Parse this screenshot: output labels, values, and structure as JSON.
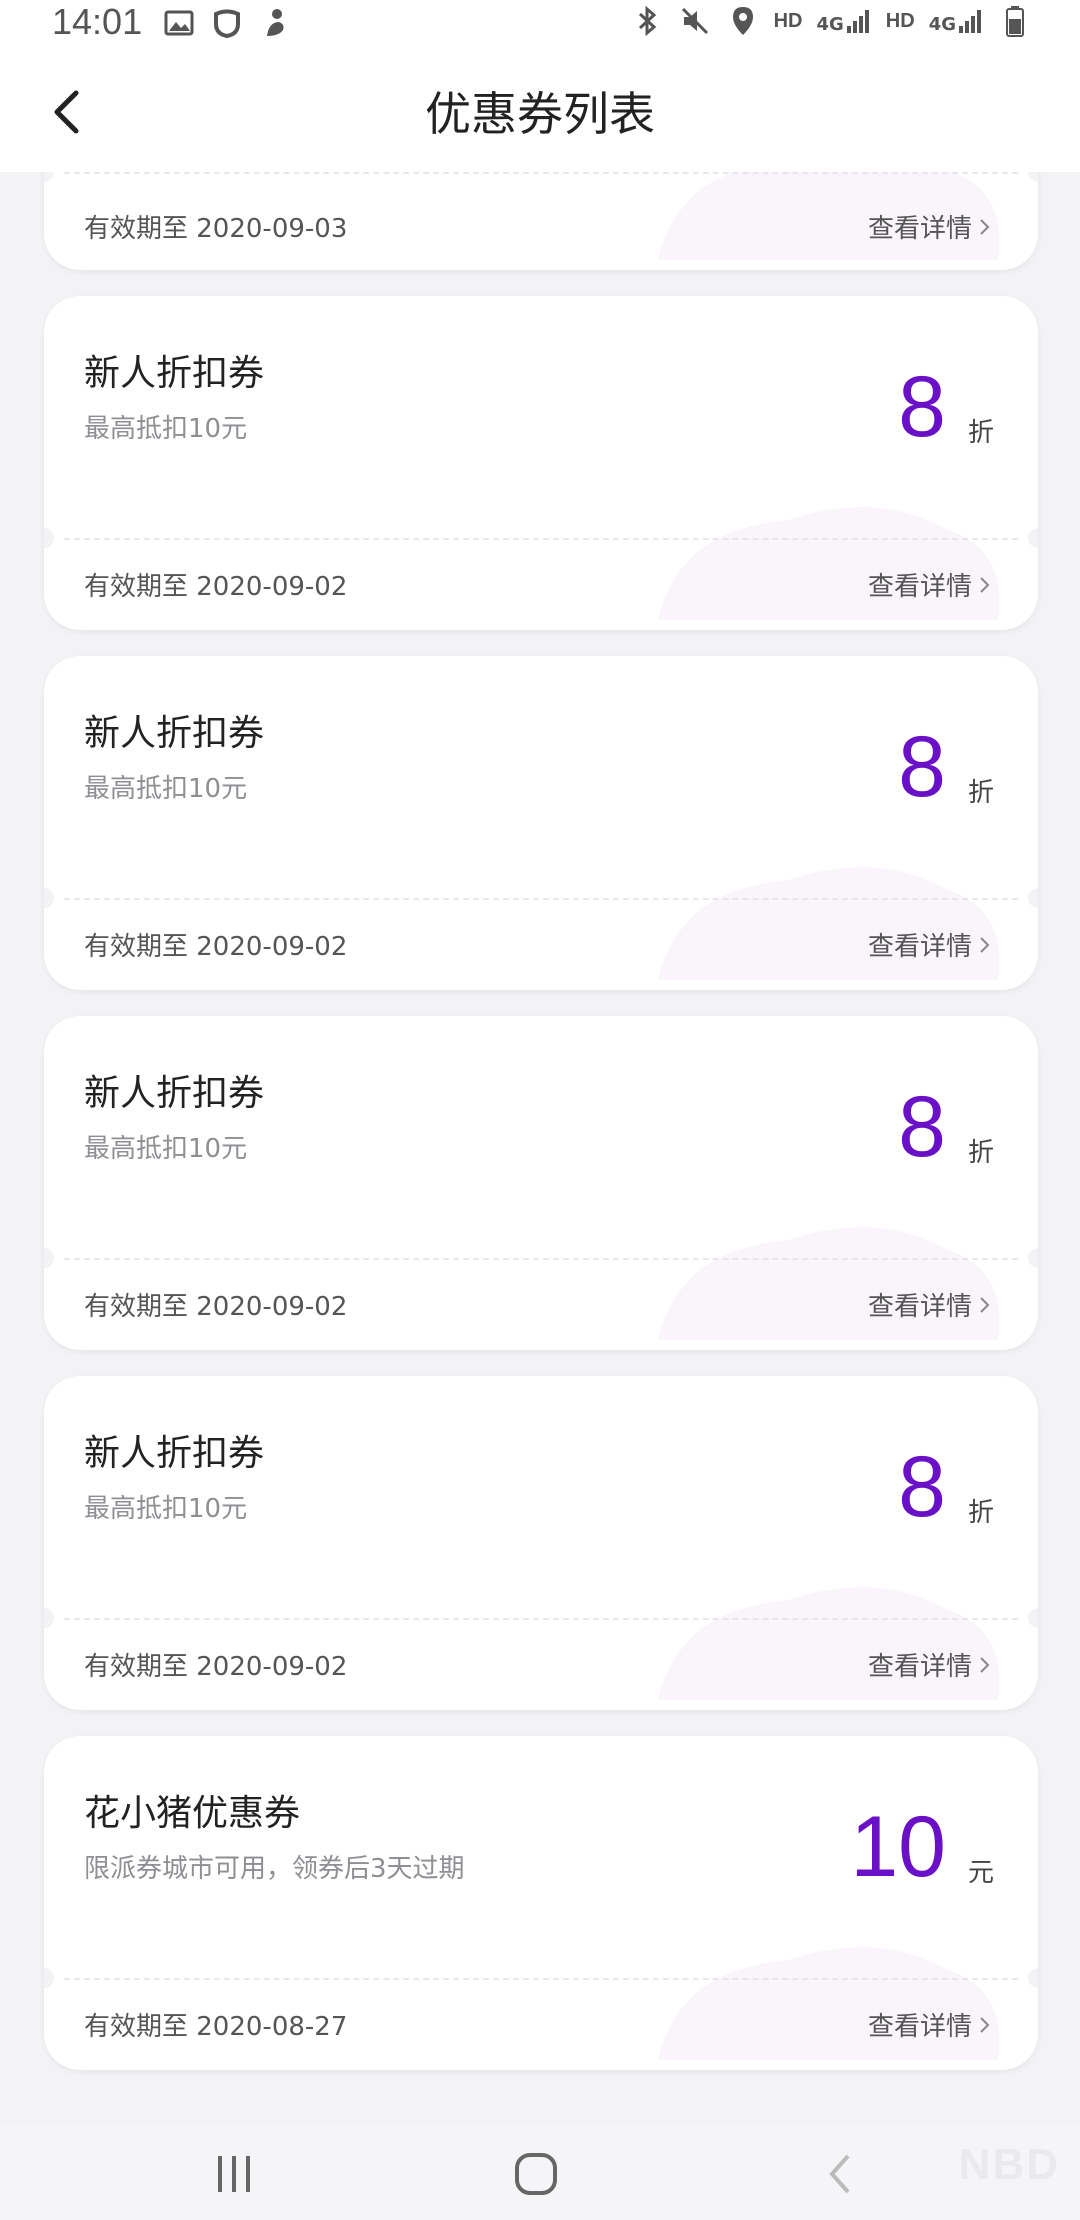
{
  "status_bar": {
    "time": "14:01",
    "left_icons": [
      "gallery-icon",
      "shield-icon",
      "dragon-icon"
    ],
    "right_icons": [
      "bluetooth-icon",
      "mute-icon",
      "location-icon",
      "signal-icon",
      "signal-icon",
      "battery-icon"
    ],
    "hd1": "HD",
    "hd2": "HD",
    "net1": "4G",
    "net2": "4G"
  },
  "header": {
    "title": "优惠券列表",
    "back_icon": "back-arrow-icon"
  },
  "colors": {
    "accent": "#6a10c7",
    "background": "#f3f3f5"
  },
  "coupons": [
    {
      "name": "",
      "desc": "",
      "value": "",
      "unit": "",
      "expiry": "有效期至 2020-09-03",
      "detail": "查看详情"
    },
    {
      "name": "新人折扣券",
      "desc": "最高抵扣10元",
      "value": "8",
      "unit": "折",
      "expiry": "有效期至 2020-09-02",
      "detail": "查看详情"
    },
    {
      "name": "新人折扣券",
      "desc": "最高抵扣10元",
      "value": "8",
      "unit": "折",
      "expiry": "有效期至 2020-09-02",
      "detail": "查看详情"
    },
    {
      "name": "新人折扣券",
      "desc": "最高抵扣10元",
      "value": "8",
      "unit": "折",
      "expiry": "有效期至 2020-09-02",
      "detail": "查看详情"
    },
    {
      "name": "新人折扣券",
      "desc": "最高抵扣10元",
      "value": "8",
      "unit": "折",
      "expiry": "有效期至 2020-09-02",
      "detail": "查看详情"
    },
    {
      "name": "花小猪优惠券",
      "desc": "限派券城市可用，领券后3天过期",
      "value": "10",
      "unit": "元",
      "expiry": "有效期至 2020-08-27",
      "detail": "查看详情"
    }
  ],
  "nav_bar": {
    "icons": [
      "recent-apps-icon",
      "home-icon",
      "back-icon"
    ]
  },
  "watermark": "NBD"
}
